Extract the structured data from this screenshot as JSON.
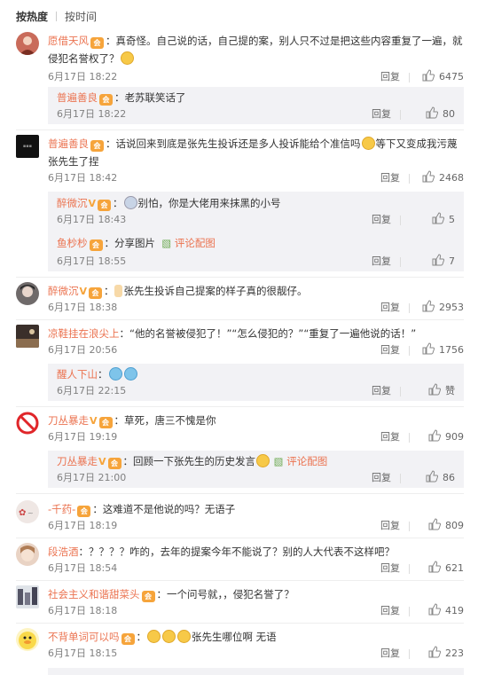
{
  "tabs": {
    "hot": "按热度",
    "time": "按时间"
  },
  "ui": {
    "reply": "回复",
    "vip": "会"
  },
  "comments": [
    {
      "user": "愿借天风",
      "text": "：真奇怪。自己说的话，自己提的案，别人只不过是把这些内容重复了一遍，就侵犯名誉权了？",
      "time": "6月17日 18:22",
      "likes": "6475",
      "replies": [
        {
          "user": "普遍善良",
          "text": "：老苏联笑话了",
          "time": "6月17日 18:22",
          "likes": "80"
        }
      ]
    },
    {
      "user": "普遍善良",
      "text": "：话说回来到底是张先生投诉还是多人投诉能给个准信吗",
      "text2": "等下又变成我污蔑张先生了捏",
      "time": "6月17日 18:42",
      "likes": "2468",
      "replies": [
        {
          "user": "醉微沉",
          "text": "别怕，你是大佬用来抹黑的小号",
          "time": "6月17日 18:43",
          "likes": "5"
        },
        {
          "user": "鱼杪杪",
          "text": "：分享图片",
          "pic": "评论配图",
          "time": "6月17日 18:55",
          "likes": "7"
        }
      ]
    },
    {
      "user": "醉微沉",
      "text": "张先生投诉自己提案的样子真的很靓仔。",
      "time": "6月17日 18:38",
      "likes": "2953"
    },
    {
      "user": "凉鞋挂在浪尖上",
      "text": "：“他的名誉被侵犯了！”“怎么侵犯的？”“重复了一遍他说的话！”",
      "time": "6月17日 20:56",
      "likes": "1756",
      "replies": [
        {
          "user": "醒人下山",
          "text": "：",
          "time": "6月17日 22:15",
          "likes": "赞"
        }
      ]
    },
    {
      "user": "刀丛暴走",
      "text": "：草死，唐三不愧是你",
      "time": "6月17日 19:19",
      "likes": "909",
      "replies": [
        {
          "user": "刀丛暴走",
          "text": "：回顾一下张先生的历史发言",
          "pic": "评论配图",
          "time": "6月17日 21:00",
          "likes": "86"
        }
      ]
    },
    {
      "user": "-千药-",
      "text": "：这难道不是他说的吗？无语子",
      "time": "6月17日 18:19",
      "likes": "809"
    },
    {
      "user": "段浩酒",
      "text": "：？？？？咋的，去年的提案今年不能说了？别的人大代表不这样吧？",
      "time": "6月17日 18:54",
      "likes": "621"
    },
    {
      "user": "社会主义和谐甜菜头",
      "text": "：一个问号就，，侵犯名誉了？",
      "time": "6月17日 18:18",
      "likes": "419"
    },
    {
      "user": "不背单词可以吗",
      "text": "张先生哪位啊 无语",
      "time": "6月17日 18:15",
      "likes": "223"
    }
  ],
  "colors": {
    "name": "#eb7350",
    "vip": "#f6a43b",
    "sub_bg": "#f2f2f5"
  }
}
